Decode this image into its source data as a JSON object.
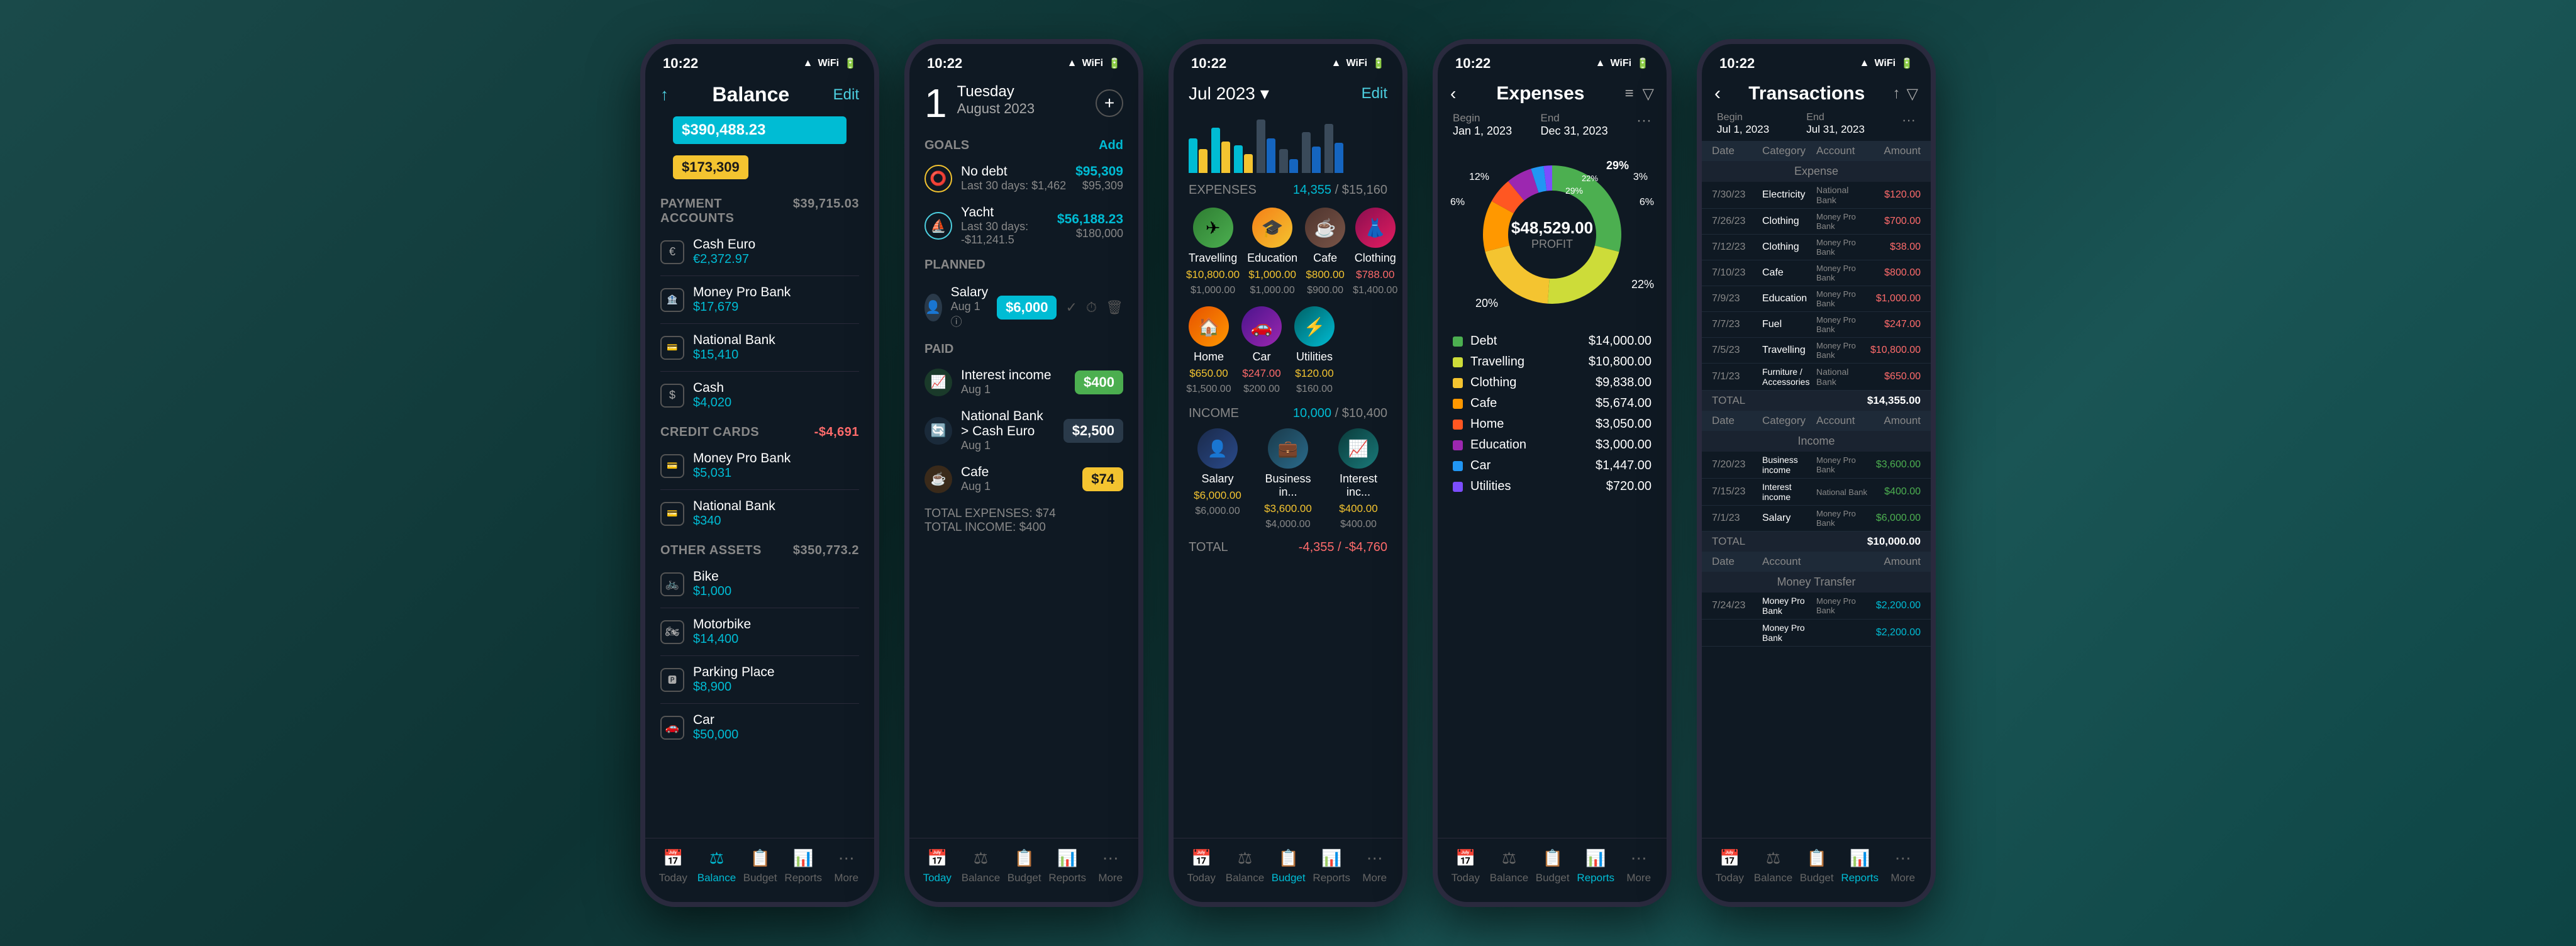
{
  "phones": [
    {
      "id": "balance",
      "status_time": "10:22",
      "header": {
        "share_icon": "↑",
        "title": "Balance",
        "edit_btn": "Edit"
      },
      "total_balance": "$390,488.23",
      "sub_balance": "$173,309",
      "sections": {
        "payment_accounts": {
          "label": "PAYMENT ACCOUNTS",
          "total": "$39,715.03",
          "items": [
            {
              "icon": "€",
              "name": "Cash Euro",
              "balance": "€2,372.97"
            },
            {
              "icon": "🏦",
              "name": "Money Pro Bank",
              "balance": "$17,679"
            },
            {
              "icon": "💳",
              "name": "National Bank",
              "balance": "$15,410"
            },
            {
              "icon": "$",
              "name": "Cash",
              "balance": "$4,020"
            }
          ]
        },
        "credit_cards": {
          "label": "CREDIT CARDS",
          "total": "-$4,691",
          "items": [
            {
              "icon": "💳",
              "name": "Money Pro Bank",
              "balance": "$5,031"
            },
            {
              "icon": "💳",
              "name": "National Bank",
              "balance": "$340"
            }
          ]
        },
        "other_assets": {
          "label": "OTHER ASSETS",
          "total": "$350,773.2",
          "items": [
            {
              "icon": "🚲",
              "name": "Bike",
              "balance": "$1,000"
            },
            {
              "icon": "🏍",
              "name": "Motorbike",
              "balance": "$14,400"
            },
            {
              "icon": "🅿",
              "name": "Parking Place",
              "balance": "$8,900"
            },
            {
              "icon": "🚗",
              "name": "Car",
              "balance": "$50,000"
            }
          ]
        }
      },
      "nav": [
        "Today",
        "Balance",
        "Budget",
        "Reports",
        "More"
      ],
      "nav_active": "Balance"
    },
    {
      "id": "today",
      "status_time": "10:22",
      "date_num": "1",
      "weekday": "Tuesday",
      "month_year": "August 2023",
      "goals_label": "GOALS",
      "add_label": "Add",
      "goals": [
        {
          "icon": "⭕",
          "name": "No debt",
          "sub": "Last 30 days: $1,462",
          "amount": "$95,309",
          "total": "$95,309"
        },
        {
          "icon": "⛵",
          "name": "Yacht",
          "sub": "Last 30 days: -$11,241.5",
          "amount": "$56,188.23",
          "total": "$180,000"
        }
      ],
      "planned_label": "PLANNED",
      "planned": [
        {
          "icon": "👤",
          "name": "Salary",
          "date": "Aug 1 ⓘ",
          "amount": "$6,000",
          "amount_color": "cyan"
        }
      ],
      "paid_label": "PAID",
      "paid": [
        {
          "icon": "📈",
          "name": "Interest income",
          "date": "Aug 1",
          "amount": "$400",
          "amount_color": "green"
        },
        {
          "icon": "🔄",
          "name": "National Bank > Cash Euro",
          "date": "Aug 1",
          "amount": "$2,500",
          "amount_color": "white"
        },
        {
          "icon": "☕",
          "name": "Cafe",
          "date": "Aug 1",
          "amount": "$74",
          "amount_color": "yellow"
        }
      ],
      "totals": {
        "expenses": "TOTAL EXPENSES: $74",
        "income": "TOTAL INCOME: $400"
      },
      "nav": [
        "Today",
        "Balance",
        "Budget",
        "Reports",
        "More"
      ],
      "nav_active": "Today"
    },
    {
      "id": "budget",
      "status_time": "10:22",
      "month": "Jul 2023",
      "edit_btn": "Edit",
      "chart_bars": [
        {
          "h1": 60,
          "h2": 40
        },
        {
          "h1": 80,
          "h2": 55
        },
        {
          "h1": 50,
          "h2": 35
        },
        {
          "h1": 90,
          "h2": 60
        },
        {
          "h1": 40,
          "h2": 25
        },
        {
          "h1": 70,
          "h2": 45
        },
        {
          "h1": 85,
          "h2": 50
        }
      ],
      "expenses_label": "EXPENSES",
      "expenses_current": "14,355",
      "expenses_limit": "$15,160",
      "categories_expense": [
        {
          "icon": "✈",
          "name": "Travelling",
          "amount": "$10,800.00",
          "budget": "$1,000.00",
          "color": "#4caf50"
        },
        {
          "icon": "🎓",
          "name": "Education",
          "amount": "$1,000.00",
          "budget": "$1,000.00",
          "color": "#f4c430"
        },
        {
          "icon": "☕",
          "name": "Cafe",
          "amount": "$800.00",
          "budget": "$900.00",
          "color": "#795548"
        },
        {
          "icon": "👗",
          "name": "Clothing",
          "amount": "$788.00",
          "budget": "$1,400.00",
          "color": "#e91e63"
        }
      ],
      "categories_expense2": [
        {
          "icon": "🏠",
          "name": "Home",
          "amount": "$650.00",
          "budget": "$1,500.00",
          "color": "#ff9800"
        },
        {
          "icon": "🚗",
          "name": "Car",
          "amount": "$247.00",
          "budget": "$200.00",
          "color": "#9c27b0"
        },
        {
          "icon": "⚡",
          "name": "Utilities",
          "amount": "$120.00",
          "budget": "$160.00",
          "color": "#00bcd4"
        }
      ],
      "income_label": "INCOME",
      "income_current": "10,000",
      "income_limit": "$10,400",
      "income_categories": [
        {
          "icon": "👤",
          "name": "Salary",
          "amount": "$6,000.00",
          "budget": "$6,000.00"
        },
        {
          "icon": "💼",
          "name": "Business in...",
          "amount": "$3,600.00",
          "budget": "$4,000.00"
        },
        {
          "icon": "📈",
          "name": "Interest inc...",
          "amount": "$400.00",
          "budget": "$400.00"
        }
      ],
      "total_label": "TOTAL",
      "total_value": "-4,355 / -$4,760",
      "nav": [
        "Today",
        "Balance",
        "Budget",
        "Reports",
        "More"
      ],
      "nav_active": "Budget"
    },
    {
      "id": "expenses",
      "status_time": "10:22",
      "back_icon": "‹",
      "title": "Expenses",
      "filter_icons": [
        "≡",
        "▽"
      ],
      "date_begin": "Begin\nJan 1, 2023",
      "date_end": "End\nDec 31, 2023",
      "more_icon": "...",
      "donut": {
        "center_amount": "$48,529.00",
        "center_label": "PROFIT",
        "segments": [
          {
            "label": "Debt",
            "pct": 29,
            "color": "#4caf50",
            "amount": "$14,000.00"
          },
          {
            "label": "Travelling",
            "pct": 22,
            "color": "#cddc39",
            "amount": "$10,800.00"
          },
          {
            "label": "Clothing",
            "pct": 20,
            "color": "#f4c430",
            "amount": "$9,838.00"
          },
          {
            "label": "Cafe",
            "pct": 12,
            "color": "#ff9800",
            "amount": "$5,674.00"
          },
          {
            "label": "Home",
            "pct": 6,
            "color": "#ff5722",
            "amount": "$3,050.00"
          },
          {
            "label": "Education",
            "pct": 6,
            "color": "#9c27b0",
            "amount": "$3,000.00"
          },
          {
            "label": "Car",
            "pct": 3,
            "color": "#2196f3",
            "amount": "$1,447.00"
          },
          {
            "label": "Utilities",
            "pct": 2,
            "color": "#7c4dff",
            "amount": "$720.00"
          }
        ]
      },
      "nav": [
        "Today",
        "Balance",
        "Budget",
        "Reports",
        "More"
      ],
      "nav_active": "Reports"
    },
    {
      "id": "transactions",
      "status_time": "10:22",
      "back_icon": "‹",
      "title": "Transactions",
      "share_icon": "↑",
      "filter_icon": "▽",
      "date_begin": "Begin\nJul 1, 2023",
      "date_end": "End\nJul 31, 2023",
      "more_icon": "...",
      "columns": [
        "Date",
        "Category",
        "Account",
        "Amount"
      ],
      "expense_section": "Expense",
      "expenses": [
        {
          "date": "7/30/23",
          "cat": "Electricity",
          "acc": "National Bank",
          "amt": "$120.00"
        },
        {
          "date": "7/26/23",
          "cat": "Clothing",
          "acc": "Money Pro\nBank",
          "amt": "$700.00"
        },
        {
          "date": "7/12/23",
          "cat": "Clothing",
          "acc": "Money Pro\nBank",
          "amt": "$38.00"
        },
        {
          "date": "7/10/23",
          "cat": "Cafe",
          "acc": "Money Pro\nBank",
          "amt": "$800.00"
        },
        {
          "date": "7/9/23",
          "cat": "Education",
          "acc": "Money Pro\nBank",
          "amt": "$1,000.00"
        },
        {
          "date": "7/7/23",
          "cat": "Fuel",
          "acc": "Money Pro\nBank",
          "amt": "$247.00"
        },
        {
          "date": "7/5/23",
          "cat": "Travelling",
          "acc": "Money Pro\nBank",
          "amt": "$10,800.00"
        },
        {
          "date": "7/1/23",
          "cat": "Furniture / Accessories",
          "acc": "National Bank",
          "amt": "$650.00"
        }
      ],
      "expense_total": "TOTAL",
      "expense_total_val": "$14,355.00",
      "income_section": "Income",
      "incomes": [
        {
          "date": "7/20/23",
          "cat": "Business income",
          "acc": "Money Pro Bank",
          "amt": "$3,600.00"
        },
        {
          "date": "7/15/23",
          "cat": "Interest income",
          "acc": "National Bank",
          "amt": "$400.00"
        },
        {
          "date": "7/1/23",
          "cat": "Salary",
          "acc": "Money Pro Bank",
          "amt": "$6,000.00"
        }
      ],
      "income_total": "TOTAL",
      "income_total_val": "$10,000.00",
      "transfer_section": "Money Transfer",
      "transfers": [
        {
          "date": "7/24/23",
          "cat": "Money Pro Bank",
          "acc": "Money Pro Bank",
          "amt": "$2,200.00"
        },
        {
          "date": "",
          "cat": "Money Pro Bank",
          "acc": "",
          "amt": "$2,200.00"
        }
      ],
      "nav": [
        "Today",
        "Balance",
        "Budget",
        "Reports",
        "More"
      ],
      "nav_active": "Reports"
    }
  ]
}
